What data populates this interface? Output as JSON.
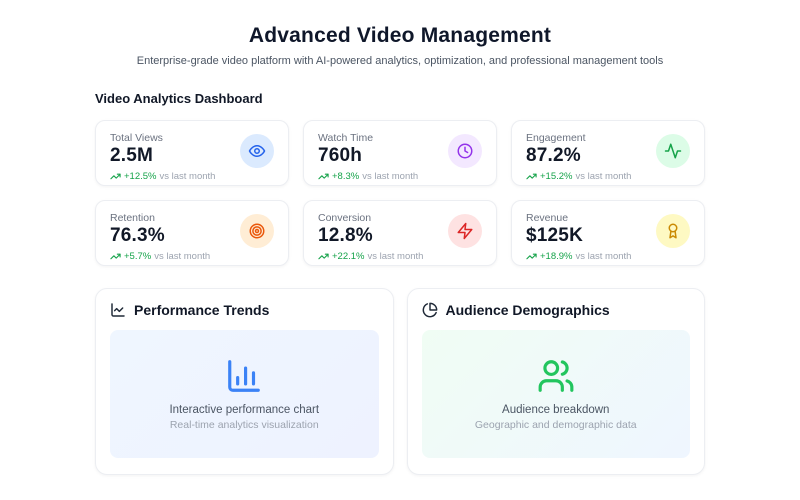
{
  "header": {
    "title": "Advanced Video Management",
    "subtitle": "Enterprise-grade video platform with AI-powered analytics, optimization, and professional management tools"
  },
  "dashboard": {
    "section_title": "Video Analytics Dashboard",
    "stats": [
      {
        "label": "Total Views",
        "value": "2.5M",
        "change": "+12.5%",
        "suffix": "vs last month",
        "icon": "eye-icon",
        "icon_color": "#2563eb",
        "icon_bg": "#dbeafe"
      },
      {
        "label": "Watch Time",
        "value": "760h",
        "change": "+8.3%",
        "suffix": "vs last month",
        "icon": "clock-icon",
        "icon_color": "#9333ea",
        "icon_bg": "#f3e8ff"
      },
      {
        "label": "Engagement",
        "value": "87.2%",
        "change": "+15.2%",
        "suffix": "vs last month",
        "icon": "activity-icon",
        "icon_color": "#16a34a",
        "icon_bg": "#dcfce7"
      },
      {
        "label": "Retention",
        "value": "76.3%",
        "change": "+5.7%",
        "suffix": "vs last month",
        "icon": "target-icon",
        "icon_color": "#ea580c",
        "icon_bg": "#ffedd5"
      },
      {
        "label": "Conversion",
        "value": "12.8%",
        "change": "+22.1%",
        "suffix": "vs last month",
        "icon": "zap-icon",
        "icon_color": "#dc2626",
        "icon_bg": "#fee2e2"
      },
      {
        "label": "Revenue",
        "value": "$125K",
        "change": "+18.9%",
        "suffix": "vs last month",
        "icon": "award-icon",
        "icon_color": "#ca8a04",
        "icon_bg": "#fef9c3"
      }
    ],
    "panels": [
      {
        "title": "Performance Trends",
        "icon": "chart-line-icon",
        "placeholder_icon": "bar-chart-icon",
        "placeholder_title": "Interactive performance chart",
        "placeholder_subtitle": "Real-time analytics visualization"
      },
      {
        "title": "Audience Demographics",
        "icon": "pie-chart-icon",
        "placeholder_icon": "users-icon",
        "placeholder_title": "Audience breakdown",
        "placeholder_subtitle": "Geographic and demographic data"
      }
    ]
  },
  "colors": {
    "trend_green": "#16a34a",
    "text_dark": "#111827",
    "text_muted": "#6b7280",
    "text_faint": "#9ca3af",
    "chart_blue": "#3b82f6",
    "chart_green": "#22c55e",
    "card_border": "#eceef2"
  }
}
